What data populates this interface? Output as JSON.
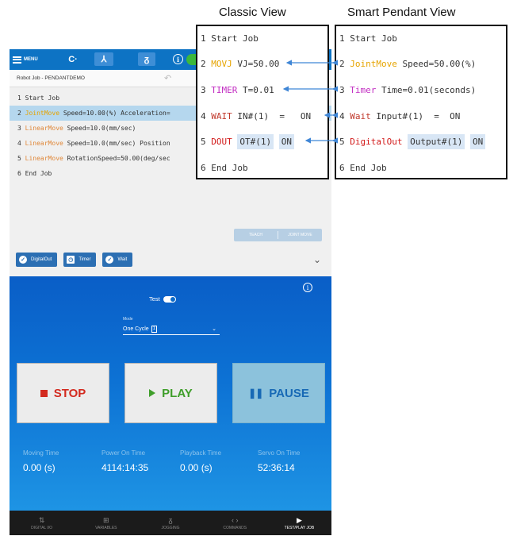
{
  "headers": {
    "classic": "Classic View",
    "smart": "Smart Pendant View"
  },
  "classic_view": {
    "lines": [
      {
        "num": "1",
        "kw": "Start Job",
        "args": ""
      },
      {
        "num": "2",
        "kw": "MOVJ",
        "args": "VJ=50.00"
      },
      {
        "num": "3",
        "kw": "TIMER",
        "args": "T=0.01"
      },
      {
        "num": "4",
        "kw": "WAIT",
        "args": "IN#(1)",
        "op": "=",
        "val": "ON"
      },
      {
        "num": "5",
        "kw": "DOUT",
        "args": "OT#(1)",
        "val": "ON"
      },
      {
        "num": "6",
        "kw": "End Job",
        "args": ""
      }
    ]
  },
  "smart_view": {
    "lines": [
      {
        "num": "1",
        "kw": "Start Job",
        "args": ""
      },
      {
        "num": "2",
        "kw": "JointMove",
        "args": "Speed=50.00(%)"
      },
      {
        "num": "3",
        "kw": "Timer",
        "args": "Time=0.01(seconds)"
      },
      {
        "num": "4",
        "kw": "Wait",
        "args": "Input#(1)",
        "op": "=",
        "val": "ON"
      },
      {
        "num": "5",
        "kw": "DigitalOut",
        "args": "Output#(1)",
        "val": "ON"
      },
      {
        "num": "6",
        "kw": "End Job",
        "args": ""
      }
    ]
  },
  "tablet": {
    "menu_label": "MENU",
    "job_title": "Robot Job - PENDANTDEMO",
    "job_lines": [
      {
        "num": "1",
        "kw": "",
        "text": "Start Job"
      },
      {
        "num": "2",
        "kw": "JointMove",
        "text": " Speed=10.00(%) Acceleration=",
        "selected": true
      },
      {
        "num": "3",
        "kw": "LinearMove",
        "text": " Speed=10.0(mm/sec)"
      },
      {
        "num": "4",
        "kw": "LinearMove",
        "text": " Speed=10.0(mm/sec) Position"
      },
      {
        "num": "5",
        "kw": "LinearMove",
        "text": " RotationSpeed=50.00(deg/sec"
      },
      {
        "num": "6",
        "kw": "",
        "text": "End Job"
      }
    ],
    "teach_label": "TEACH",
    "jointmove_label": "JOINT MOVE",
    "command_chips": [
      "DigitalOut",
      "Timer",
      "Wait"
    ],
    "test_label": "Test",
    "mode_label": "Mode",
    "mode_value": "One Cycle",
    "mode_box": "1",
    "buttons": {
      "stop": "STOP",
      "play": "PLAY",
      "pause": "PAUSE"
    },
    "stats": [
      {
        "label": "Moving Time",
        "value": "0.00 (s)"
      },
      {
        "label": "Power On Time",
        "value": "4114:14:35"
      },
      {
        "label": "Playback Time",
        "value": "0.00 (s)"
      },
      {
        "label": "Servo On Time",
        "value": "52:36:14"
      }
    ],
    "nav": [
      {
        "label": "DIGITAL I/O",
        "icon": "digital-io-icon"
      },
      {
        "label": "VARIABLES",
        "icon": "variables-icon"
      },
      {
        "label": "JOGGING",
        "icon": "jogging-icon"
      },
      {
        "label": "COMMANDS",
        "icon": "commands-icon"
      },
      {
        "label": "TEST/PLAY JOB",
        "icon": "play-icon",
        "active": true
      }
    ]
  },
  "colors": {
    "topbar": "#0d73c4",
    "play_panel": "#0d72d4",
    "arrow": "#3f86d6",
    "jointmove": "#e6a400",
    "timer": "#c22ec2",
    "wait": "#c0382b",
    "dout": "#d21a1a"
  }
}
